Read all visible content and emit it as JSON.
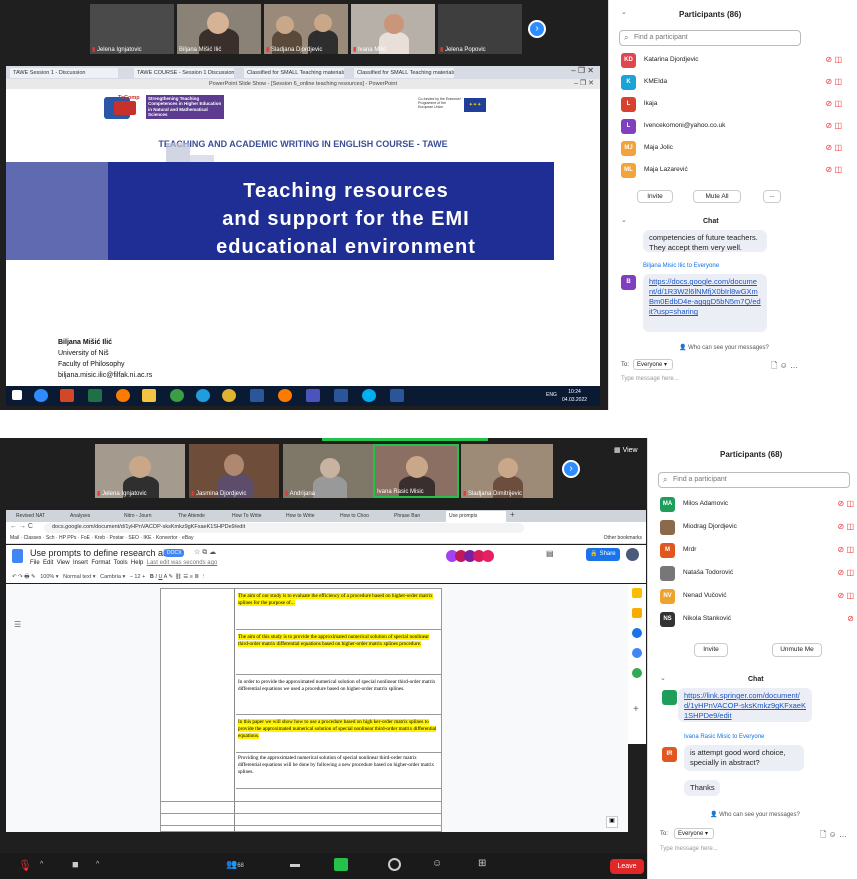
{
  "top": {
    "tiles": [
      {
        "name": "Jelena Ignjatovic"
      },
      {
        "name": "Biljana Mišić Ilić"
      },
      {
        "name": "Sladjana Djordjevic"
      },
      {
        "name": "Ivana Milic"
      },
      {
        "name": "Jelena Popovic"
      }
    ],
    "browser_tabs": [
      "TAWE Session 1 - Discussion",
      "TAWE COURSE - Session 1 Discussion",
      "Classified for SMALL Teaching materials",
      "Classified for SMALL Teaching materials"
    ],
    "ppt_title": "PowerPoint Slide Show - [Session 6_online teaching resources] - PowerPoint",
    "slide": {
      "logo": "TeComp",
      "logo_text": "Strengthening Teaching Competences in Higher Education in Natural and Mathematical Sciences",
      "eu_text": "Co-funded by the Erasmus+ Programme of the European Union",
      "course": "TEACHING AND ACADEMIC WRITING IN ENGLISH COURSE  - TAWE",
      "title_l1": "Teaching resources",
      "title_l2": "and support for the EMI",
      "title_l3": "educational environment",
      "author": "Biljana Mišić Ilić",
      "uni": "University of Niš",
      "faculty": "Faculty of Philosophy",
      "email": "biljana.misic.ilic@filfak.ni.ac.rs"
    },
    "clock": "10:24",
    "date": "04.03.2022",
    "lang": "ENG",
    "panel": {
      "title": "Participants (86)",
      "search": "Find a participant",
      "participants": [
        {
          "initials": "KD",
          "name": "Katarina Djordjevic",
          "color": "#e0464f"
        },
        {
          "initials": "K",
          "name": "KMEIda",
          "color": "#1aa3d9"
        },
        {
          "initials": "L",
          "name": "lkaja",
          "color": "#d9412f"
        },
        {
          "initials": "L",
          "name": "lvencekomoni@yahoo.co.uk",
          "color": "#7f3fbf"
        },
        {
          "initials": "MJ",
          "name": "Maja Jolic",
          "color": "#f2a33a"
        },
        {
          "initials": "ML",
          "name": "Maja Lazarević",
          "color": "#f2a33a"
        }
      ],
      "invite": "Invite",
      "mute_all": "Mute All",
      "more": "...",
      "chat_title": "Chat",
      "chat_prev": "competencies of future teachers. They accept them very well.",
      "sender": "Biljana Misic Ilic to Everyone",
      "sender_initial": "B",
      "link": "https://docs.google.com/document/d/1R3W2l6lNMfjX0bIrl8wGXmBm0EdbD4e-agqgD5bN5m7Q/edit?usp=sharing",
      "who": "Who can see your messages?",
      "to_label": "To:",
      "to_value": "Everyone",
      "placeholder": "Type message here..."
    }
  },
  "bottom": {
    "view_label": "View",
    "tiles": [
      {
        "name": "Jelena Ignjatovic"
      },
      {
        "name": "Jasmina Djordjevic"
      },
      {
        "name": "Andrijana"
      },
      {
        "name": "Ivana Rasic Misic"
      },
      {
        "name": "Sladjana Dimitrijevic"
      }
    ],
    "browser_tabs": [
      "Revised NAT",
      "Analyses",
      "Nitro - Journ",
      "The Attende",
      "How To Write",
      "How to Write",
      "How to Choo",
      "Phrase Ban",
      "Use prompts"
    ],
    "url": "docs.google.com/document/d/1yHPnVACOP-sksKmkz9gKFxaeK1SHPDe9/edit",
    "bookmarks": [
      "Mail",
      "Classes",
      "Sch",
      "HP PPs",
      "FoE",
      "Kreb",
      "Postar",
      "SEO",
      "IKE",
      "Konvertor",
      "eBay",
      "Other bookmarks"
    ],
    "doc_title": "Use prompts to define research aims",
    "doc_badge": "DOCX",
    "last_edit": "Last edit was seconds ago",
    "menu": [
      "File",
      "Edit",
      "View",
      "Insert",
      "Format",
      "Tools",
      "Help"
    ],
    "zoom": "100%",
    "style": "Normal text",
    "font": "Cambria",
    "font_size": "12",
    "share": "Share",
    "paragraphs": [
      "The aim of our study is to evaluate the efficiency of a procedure based on higher-order matrix splines for the purpose of...",
      "The aim of this study is to provide the approximated numerical solution of special nonlinear third-order matrix differential equations based on higher-order matrix splines procedure.",
      "In order to provide the approximated numerical solution of special nonlinear third-order matrix differential equations we used a procedure based on higher-order matrix splines.",
      "In this paper we will show how to use a procedure based on high ker-order matrix splines to provide the approximated numerical solution of special nonlinear third-order matrix differential equations.",
      "Providing the approximated numerical solution of special nonlinear third-order matrix differential equations will be done by following a new procedure based on higher-order matrix splines."
    ],
    "panel": {
      "title": "Participants (68)",
      "search": "Find a participant",
      "participants": [
        {
          "initials": "MA",
          "name": "Milos Adamovic",
          "color": "#1e9e5a"
        },
        {
          "initials": "",
          "name": "Miodrag Djordjevic",
          "color": "#8a6a4a"
        },
        {
          "initials": "M",
          "name": "Mrdr",
          "color": "#e0581f"
        },
        {
          "initials": "",
          "name": "Nataša Todorović",
          "color": "#777777"
        },
        {
          "initials": "NV",
          "name": "Nenad Vučović",
          "color": "#f0a22e"
        },
        {
          "initials": "NS",
          "name": "Nikola Stanković",
          "color": "#333333"
        }
      ],
      "invite": "Invite",
      "unmute": "Unmute Me",
      "chat_title": "Chat",
      "chat_link": "https://link.springer.com/document/d/1yHPnVACOP-sksKmkz9gKFxaeK1SHPDe9/edit",
      "sender": "Ivana Rasic Misic to Everyone",
      "sender_initial": "IR",
      "msg1": "is attempt good word choice, specially in abstract?",
      "msg2": "Thanks",
      "who": "Who can see your messages?",
      "to_label": "To:",
      "to_value": "Everyone",
      "placeholder": "Type message here..."
    },
    "toolbar": {
      "participants_count": "68",
      "leave": "Leave"
    }
  }
}
